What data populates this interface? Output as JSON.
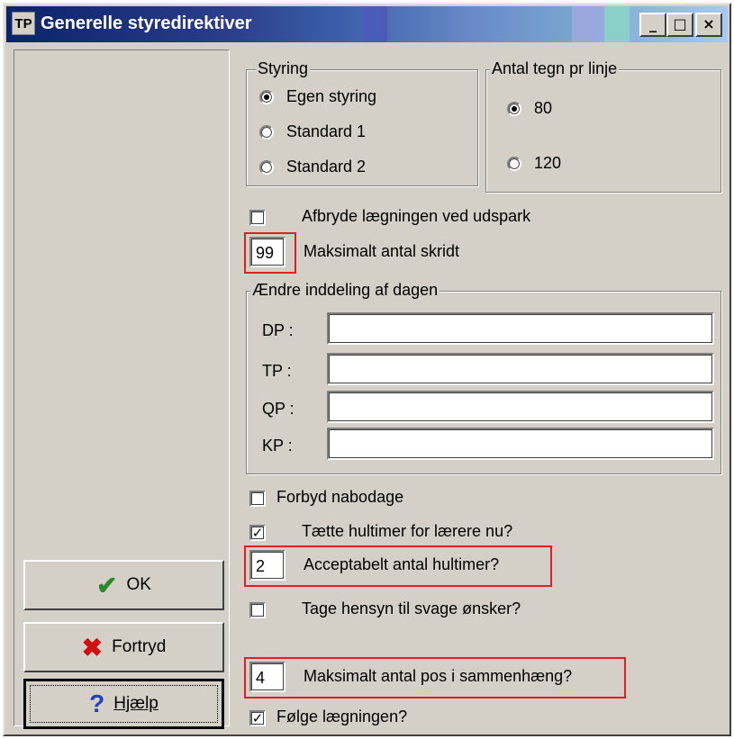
{
  "window": {
    "title": "Generelle styredirektiver",
    "app_icon_text": "TP",
    "controls": {
      "minimize": "_",
      "maximize": "□",
      "close": "×"
    }
  },
  "buttons": {
    "ok": {
      "label": "OK",
      "icon": "checkmark-icon"
    },
    "cancel": {
      "label": "Fortryd",
      "icon": "cross-icon"
    },
    "help": {
      "label": "Hjælp",
      "icon": "question-icon"
    }
  },
  "styring": {
    "legend": "Styring",
    "options": [
      "Egen styring",
      "Standard 1",
      "Standard 2"
    ],
    "selected": "Egen styring"
  },
  "antal_tegn": {
    "legend": "Antal tegn pr linje",
    "options": [
      "80",
      "120"
    ],
    "selected": "80"
  },
  "afbryde": {
    "label": "Afbryde lægningen ved udspark",
    "checked": false
  },
  "maks_skridt": {
    "value": "99",
    "label": "Maksimalt antal skridt"
  },
  "inddeling": {
    "legend": "Ændre inddeling af dagen",
    "rows": [
      {
        "label": "DP :",
        "value": ""
      },
      {
        "label": "TP :",
        "value": ""
      },
      {
        "label": "QP :",
        "value": ""
      },
      {
        "label": "KP :",
        "value": ""
      }
    ]
  },
  "forbyd": {
    "label": "Forbyd nabodage",
    "checked": false
  },
  "taette": {
    "label": "Tætte hultimer for lærere nu?",
    "checked": true
  },
  "acceptabelt": {
    "value": "2",
    "label": "Acceptabelt antal hultimer?"
  },
  "tage_hensyn": {
    "label": "Tage hensyn til svage ønsker?",
    "checked": false
  },
  "maks_pos": {
    "value": "4",
    "label": "Maksimalt antal pos i sammenhæng?"
  },
  "folge": {
    "label": "Følge lægningen?",
    "checked": true
  },
  "colors": {
    "highlight_box": "#e02020",
    "title_start": "#0a246a",
    "title_end": "#a6caf0"
  }
}
